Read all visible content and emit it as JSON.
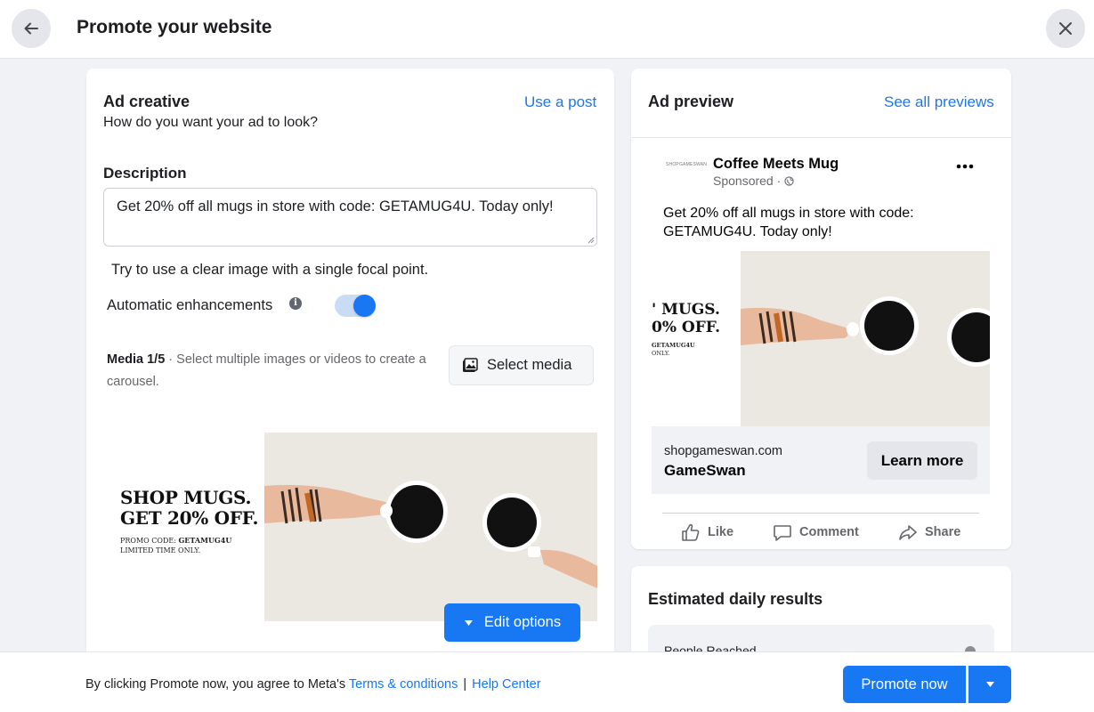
{
  "header": {
    "title": "Promote your website",
    "back_icon": "arrow-left-icon",
    "close_icon": "close-icon"
  },
  "creative": {
    "title": "Ad creative",
    "use_post_link": "Use a post",
    "subtitle": "How do you want your ad to look?",
    "description_label": "Description",
    "description_value": "Get 20% off all mugs in store with code: GETAMUG4U. Today only!",
    "image_tip": "Try to use a clear image with a single focal point.",
    "auto_enhancements_label": "Automatic enhancements",
    "auto_enhancements_on": true,
    "media_count": "Media 1/5",
    "media_hint": " · Select multiple images or videos to create a carousel.",
    "select_media_label": "Select media",
    "edit_options_label": "Edit options",
    "ad_image": {
      "headline_line1": "SHOP MUGS.",
      "headline_line2": "GET 20% OFF.",
      "promo_prefix": "PROMO CODE: ",
      "promo_code": "GETAMUG4U",
      "limited": "LIMITED TIME ONLY."
    }
  },
  "preview": {
    "title": "Ad preview",
    "see_all_link": "See all previews",
    "page_logo_text": "SHOPGAMESWAN",
    "page_name": "Coffee Meets Mug",
    "sponsored": "Sponsored · ",
    "post_text": "Get 20% off all mugs in store with code: GETAMUG4U. Today only!",
    "ad_image": {
      "headline_line1": "' MUGS.",
      "headline_line2": "0% OFF.",
      "promo_code": "GETAMUG4U",
      "limited": "ONLY."
    },
    "link_domain": "shopgameswan.com",
    "link_name": "GameSwan",
    "cta_label": "Learn more",
    "actions": {
      "like": "Like",
      "comment": "Comment",
      "share": "Share"
    }
  },
  "results": {
    "title": "Estimated daily results",
    "people_reached_label": "People Reached"
  },
  "footer": {
    "agree_text": "By clicking Promote now, you agree to Meta's ",
    "terms_link": "Terms & conditions",
    "separator": "|",
    "help_link": "Help Center",
    "promote_label": "Promote now"
  },
  "colors": {
    "accent": "#1877f2",
    "background": "#f0f2f5",
    "card": "#ffffff",
    "text": "#1c1e21",
    "muted": "#65676b"
  }
}
